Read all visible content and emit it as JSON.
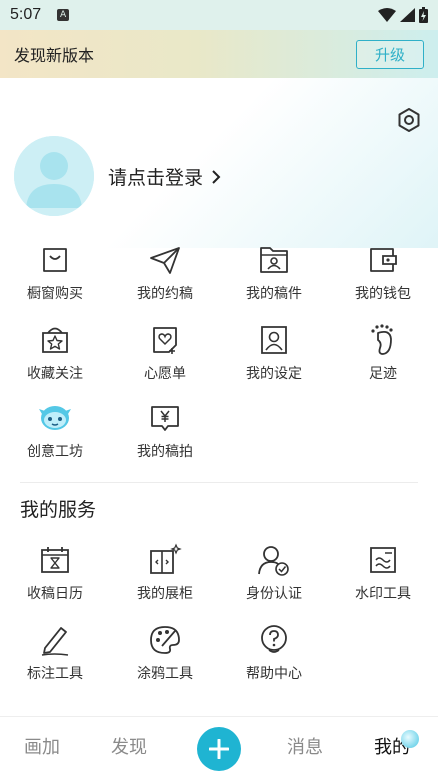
{
  "status_bar": {
    "time": "5:07",
    "icons": [
      "notification-a-icon",
      "wifi-icon",
      "signal-icon",
      "battery-icon"
    ]
  },
  "update_banner": {
    "text": "发现新版本",
    "button_label": "升级"
  },
  "profile": {
    "login_text": "请点击登录",
    "icons": [
      "settings-hex-icon",
      "avatar-icon",
      "chevron-right-icon"
    ]
  },
  "grid_items": [
    {
      "label": "橱窗购买",
      "icon": "shopping-bag-icon"
    },
    {
      "label": "我的约稿",
      "icon": "paper-plane-icon"
    },
    {
      "label": "我的稿件",
      "icon": "folder-person-icon"
    },
    {
      "label": "我的钱包",
      "icon": "wallet-icon"
    },
    {
      "label": "收藏关注",
      "icon": "star-box-icon"
    },
    {
      "label": "心愿单",
      "icon": "heart-note-icon"
    },
    {
      "label": "我的设定",
      "icon": "profile-card-icon"
    },
    {
      "label": "足迹",
      "icon": "footprint-icon"
    },
    {
      "label": "创意工坊",
      "icon": "mascot-icon"
    },
    {
      "label": "我的稿拍",
      "icon": "yen-bubble-icon"
    }
  ],
  "services": {
    "title": "我的服务",
    "items": [
      {
        "label": "收稿日历",
        "icon": "calendar-hourglass-icon"
      },
      {
        "label": "我的展柜",
        "icon": "showcase-icon"
      },
      {
        "label": "身份认证",
        "icon": "verified-user-icon"
      },
      {
        "label": "水印工具",
        "icon": "watermark-icon"
      },
      {
        "label": "标注工具",
        "icon": "pen-icon"
      },
      {
        "label": "涂鸦工具",
        "icon": "palette-icon"
      },
      {
        "label": "帮助中心",
        "icon": "help-bubble-icon"
      }
    ]
  },
  "tab_bar": {
    "tabs": [
      "画加",
      "发现",
      "消息",
      "我的"
    ],
    "active": "我的",
    "accent": "#1fb4d2"
  }
}
